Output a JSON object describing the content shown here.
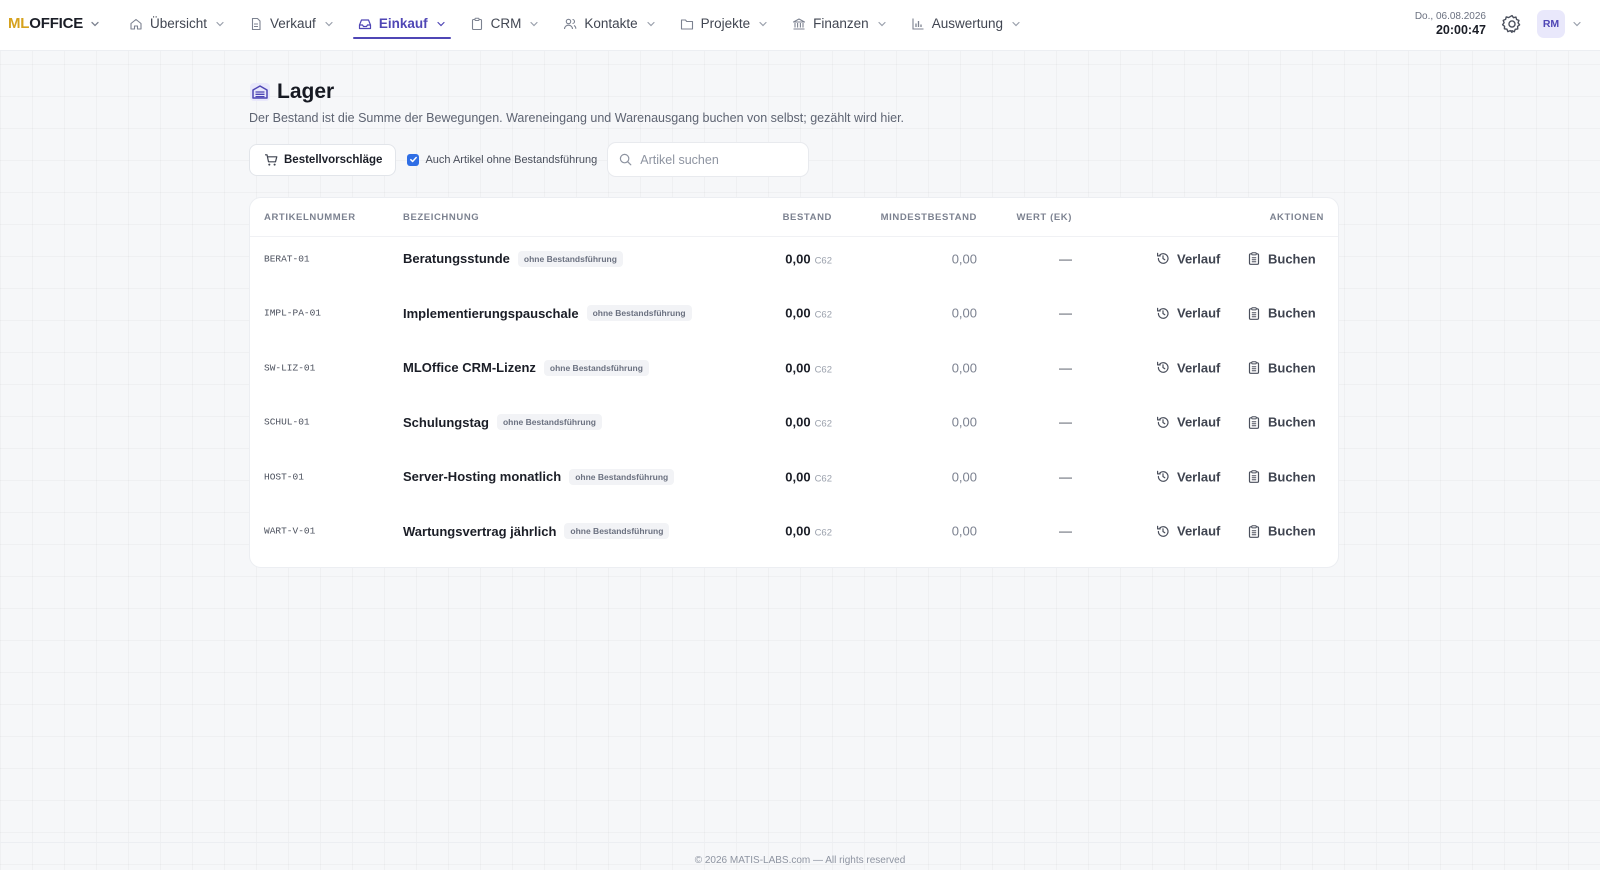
{
  "brand": {
    "part1": "ML",
    "part2": "OFFICE"
  },
  "nav": [
    {
      "label": "Übersicht",
      "icon": "home-icon",
      "active": false
    },
    {
      "label": "Verkauf",
      "icon": "document-icon",
      "active": false
    },
    {
      "label": "Einkauf",
      "icon": "inbox-icon",
      "active": true
    },
    {
      "label": "CRM",
      "icon": "clipboard-icon",
      "active": false
    },
    {
      "label": "Kontakte",
      "icon": "users-icon",
      "active": false
    },
    {
      "label": "Projekte",
      "icon": "folder-icon",
      "active": false
    },
    {
      "label": "Finanzen",
      "icon": "bank-icon",
      "active": false
    },
    {
      "label": "Auswertung",
      "icon": "bar-chart-icon",
      "active": false
    }
  ],
  "clock": {
    "date": "Do., 06.08.2026",
    "time": "20:00:47"
  },
  "user": {
    "initials": "RM"
  },
  "page": {
    "title": "Lager",
    "subtitle": "Der Bestand ist die Summe der Bewegungen. Wareneingang und Warenausgang buchen von selbst; gezählt wird hier."
  },
  "toolbar": {
    "orders_label": "Bestellvorschläge",
    "checkbox_label": "Auch Artikel ohne Bestandsführung",
    "checkbox_checked": true,
    "search_placeholder": "Artikel suchen",
    "search_value": ""
  },
  "table": {
    "headers": {
      "sku": "ARTIKELNUMMER",
      "name": "BEZEICHNUNG",
      "stock": "BESTAND",
      "min": "MINDESTBESTAND",
      "value": "WERT (EK)",
      "actions": "AKTIONEN"
    },
    "history_label": "Verlauf",
    "book_label": "Buchen",
    "rows": [
      {
        "sku": "BERAT-01",
        "name": "Beratungsstunde",
        "badge": "ohne Bestandsführung",
        "stock": "0,00",
        "unit": "C62",
        "min": "0,00",
        "value": "—"
      },
      {
        "sku": "IMPL-PA-01",
        "name": "Implementierungspauschale",
        "badge": "ohne Bestandsführung",
        "stock": "0,00",
        "unit": "C62",
        "min": "0,00",
        "value": "—"
      },
      {
        "sku": "SW-LIZ-01",
        "name": "MLOffice CRM-Lizenz",
        "badge": "ohne Bestandsführung",
        "stock": "0,00",
        "unit": "C62",
        "min": "0,00",
        "value": "—"
      },
      {
        "sku": "SCHUL-01",
        "name": "Schulungstag",
        "badge": "ohne Bestandsführung",
        "stock": "0,00",
        "unit": "C62",
        "min": "0,00",
        "value": "—"
      },
      {
        "sku": "HOST-01",
        "name": "Server-Hosting monatlich",
        "badge": "ohne Bestandsführung",
        "stock": "0,00",
        "unit": "C62",
        "min": "0,00",
        "value": "—"
      },
      {
        "sku": "WART-V-01",
        "name": "Wartungsvertrag jährlich",
        "badge": "ohne Bestandsführung",
        "stock": "0,00",
        "unit": "C62",
        "min": "0,00",
        "value": "—"
      }
    ]
  },
  "footer": "© 2026 MATIS-LABS.com — All rights reserved",
  "colors": {
    "accent": "#4f46b5",
    "brand_gold": "#d6a21e",
    "checkbox": "#2f6ee5"
  }
}
